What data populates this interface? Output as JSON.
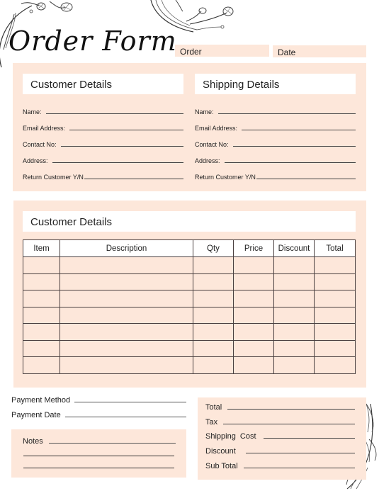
{
  "header": {
    "title": "Order Form",
    "order_label": "Order",
    "date_label": "Date"
  },
  "customer_details": {
    "title": "Customer Details",
    "fields": [
      "Name:",
      "Email Address:",
      "Contact No:",
      "Address:",
      "Return Customer Y/N"
    ]
  },
  "shipping_details": {
    "title": "Shipping Details",
    "fields": [
      "Name:",
      "Email Address:",
      "Contact No:",
      "Address:",
      "Return Customer Y/N"
    ]
  },
  "items_section": {
    "title": "Customer Details",
    "columns": [
      "Item",
      "Description",
      "Qty",
      "Price",
      "Discount",
      "Total"
    ],
    "rows": [
      [
        "",
        "",
        "",
        "",
        "",
        ""
      ],
      [
        "",
        "",
        "",
        "",
        "",
        ""
      ],
      [
        "",
        "",
        "",
        "",
        "",
        ""
      ],
      [
        "",
        "",
        "",
        "",
        "",
        ""
      ],
      [
        "",
        "",
        "",
        "",
        "",
        ""
      ],
      [
        "",
        "",
        "",
        "",
        "",
        ""
      ],
      [
        "",
        "",
        "",
        "",
        "",
        ""
      ]
    ]
  },
  "payment": {
    "method_label": "Payment Method",
    "date_label": "Payment Date"
  },
  "notes": {
    "label": "Notes"
  },
  "summary": {
    "fields": [
      "Total",
      "Tax",
      "Shipping  Cost",
      "Discount",
      "Sub Total"
    ]
  },
  "colors": {
    "peach": "#fde7da",
    "line": "#444444"
  },
  "decorations": [
    "floral-top-left",
    "floral-top-center",
    "leaf-bottom-right"
  ]
}
